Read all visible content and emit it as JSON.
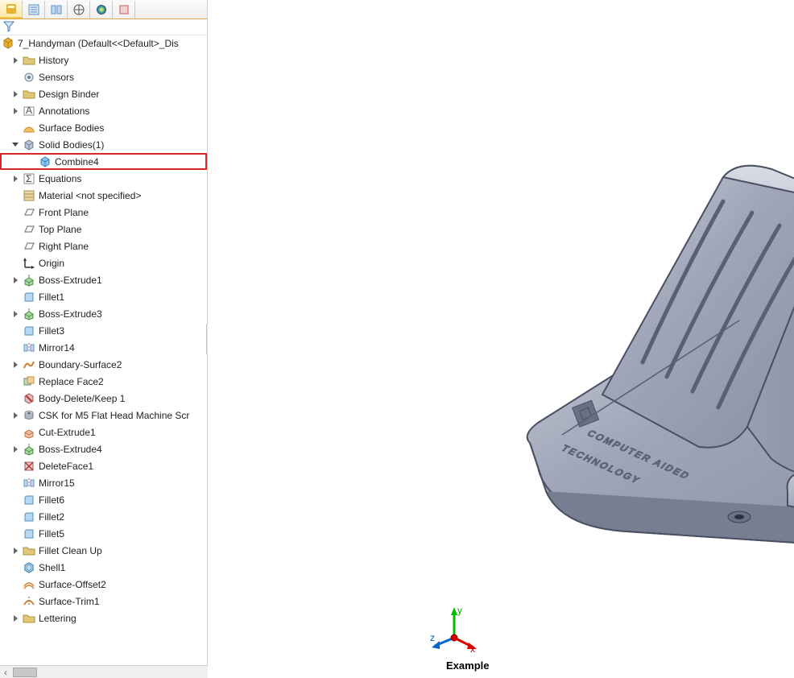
{
  "tabs": [
    "feature-manager-tab",
    "property-manager-tab",
    "configuration-manager-tab",
    "dimxpert-tab",
    "display-manager-tab",
    "cam-manager-tab"
  ],
  "root": {
    "label": "7_Handyman  (Default<<Default>_Dis"
  },
  "nodes": [
    {
      "label": "History",
      "icon": "folder-icon",
      "indent": 1,
      "exp": "collapsed"
    },
    {
      "label": "Sensors",
      "icon": "sensor-icon",
      "indent": 1,
      "exp": "none"
    },
    {
      "label": "Design Binder",
      "icon": "folder-icon",
      "indent": 1,
      "exp": "collapsed"
    },
    {
      "label": "Annotations",
      "icon": "annotation-icon",
      "indent": 1,
      "exp": "collapsed"
    },
    {
      "label": "Surface Bodies",
      "icon": "surface-icon",
      "indent": 1,
      "exp": "none"
    },
    {
      "label": "Solid Bodies(1)",
      "icon": "solid-icon",
      "indent": 1,
      "exp": "expanded"
    },
    {
      "label": "Combine4",
      "icon": "body-cube-icon",
      "indent": 2,
      "exp": "none",
      "highlight": true
    },
    {
      "label": "Equations",
      "icon": "sigma-icon",
      "indent": 1,
      "exp": "collapsed"
    },
    {
      "label": "Material <not specified>",
      "icon": "material-icon",
      "indent": 1,
      "exp": "none"
    },
    {
      "label": "Front Plane",
      "icon": "plane-icon",
      "indent": 1,
      "exp": "none"
    },
    {
      "label": "Top Plane",
      "icon": "plane-icon",
      "indent": 1,
      "exp": "none"
    },
    {
      "label": "Right Plane",
      "icon": "plane-icon",
      "indent": 1,
      "exp": "none"
    },
    {
      "label": "Origin",
      "icon": "origin-icon",
      "indent": 1,
      "exp": "none"
    },
    {
      "label": "Boss-Extrude1",
      "icon": "extrude-icon",
      "indent": 1,
      "exp": "collapsed"
    },
    {
      "label": "Fillet1",
      "icon": "fillet-icon",
      "indent": 1,
      "exp": "none"
    },
    {
      "label": "Boss-Extrude3",
      "icon": "extrude-icon",
      "indent": 1,
      "exp": "collapsed"
    },
    {
      "label": "Fillet3",
      "icon": "fillet-icon",
      "indent": 1,
      "exp": "none"
    },
    {
      "label": "Mirror14",
      "icon": "mirror-icon",
      "indent": 1,
      "exp": "none"
    },
    {
      "label": "Boundary-Surface2",
      "icon": "boundary-icon",
      "indent": 1,
      "exp": "collapsed"
    },
    {
      "label": "Replace Face2",
      "icon": "replace-face-icon",
      "indent": 1,
      "exp": "none"
    },
    {
      "label": "Body-Delete/Keep 1",
      "icon": "delete-body-icon",
      "indent": 1,
      "exp": "none"
    },
    {
      "label": "CSK for M5 Flat Head Machine Scr",
      "icon": "hole-icon",
      "indent": 1,
      "exp": "collapsed"
    },
    {
      "label": "Cut-Extrude1",
      "icon": "cut-icon",
      "indent": 1,
      "exp": "none"
    },
    {
      "label": "Boss-Extrude4",
      "icon": "extrude-icon",
      "indent": 1,
      "exp": "collapsed"
    },
    {
      "label": "DeleteFace1",
      "icon": "delete-face-icon",
      "indent": 1,
      "exp": "none"
    },
    {
      "label": "Mirror15",
      "icon": "mirror-icon",
      "indent": 1,
      "exp": "none"
    },
    {
      "label": "Fillet6",
      "icon": "fillet-icon",
      "indent": 1,
      "exp": "none"
    },
    {
      "label": "Fillet2",
      "icon": "fillet-icon",
      "indent": 1,
      "exp": "none"
    },
    {
      "label": "Fillet5",
      "icon": "fillet-icon",
      "indent": 1,
      "exp": "none"
    },
    {
      "label": "Fillet Clean Up",
      "icon": "folder-plain-icon",
      "indent": 1,
      "exp": "collapsed"
    },
    {
      "label": "Shell1",
      "icon": "shell-icon",
      "indent": 1,
      "exp": "none"
    },
    {
      "label": "Surface-Offset2",
      "icon": "offset-icon",
      "indent": 1,
      "exp": "none"
    },
    {
      "label": "Surface-Trim1",
      "icon": "trim-icon",
      "indent": 1,
      "exp": "none"
    },
    {
      "label": "Lettering",
      "icon": "folder-plain-icon",
      "indent": 1,
      "exp": "collapsed"
    }
  ],
  "viewport": {
    "axis_labels": {
      "x": "x",
      "y": "y",
      "z": "z"
    },
    "bottom_label": "Example",
    "model_text_lines": [
      "COMPUTER AIDED",
      "TECHNOLOGY"
    ]
  },
  "colors": {
    "highlight_border": "#d62828",
    "model_fill": "#a8aec0",
    "model_shadow": "#7a8096"
  }
}
